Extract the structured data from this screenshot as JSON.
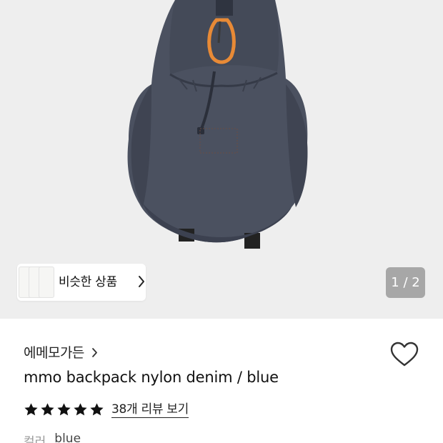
{
  "gallery": {
    "image_alt": "mmo backpack nylon denim blue",
    "similar_label": "비슷한 상품",
    "pager": "1 / 2"
  },
  "product": {
    "brand": "에메모가든",
    "title": "mmo backpack nylon denim / blue",
    "rating_stars": 5,
    "review_link": "38개 리뷰 보기",
    "option_key": "컬러",
    "option_value": "blue"
  },
  "colors": {
    "bag": "#4b5160",
    "carabiner": "#e88a36",
    "hero_bg": "#eeeeee"
  },
  "icons": [
    "chevron-right-icon",
    "heart-icon",
    "star-icon"
  ]
}
